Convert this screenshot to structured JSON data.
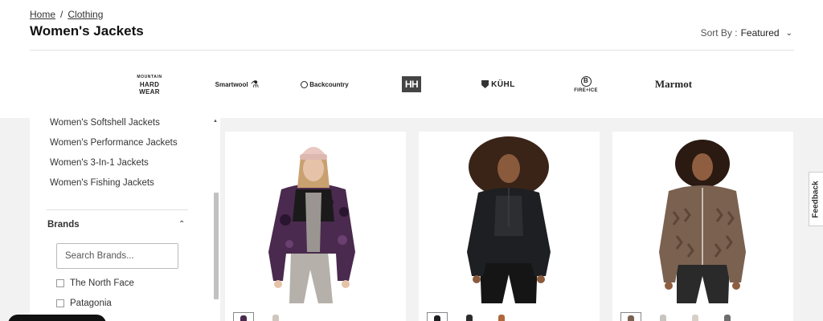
{
  "breadcrumb": {
    "home": "Home",
    "separator": "/",
    "current": "Clothing"
  },
  "page_title": "Women's Jackets",
  "sort": {
    "label": "Sort By :",
    "value": "Featured"
  },
  "brand_logos": [
    {
      "name": "Mountain Hardwear",
      "line1": "MOUNTAIN",
      "line2": "HARD",
      "line3": "WEAR"
    },
    {
      "name": "Smartwool",
      "text": "Smartwool"
    },
    {
      "name": "Backcountry",
      "text": "Backcountry"
    },
    {
      "name": "Helly Hansen",
      "text": "HH"
    },
    {
      "name": "Kuhl",
      "text": "KÜHL"
    },
    {
      "name": "Fire + Ice",
      "mark": "B",
      "text": "FIRE+ICE"
    },
    {
      "name": "Marmot",
      "text": "Marmot"
    }
  ],
  "sidebar": {
    "categories": [
      "Women's Softshell Jackets",
      "Women's Performance Jackets",
      "Women's 3-In-1 Jackets",
      "Women's Fishing Jackets"
    ],
    "brands_heading": "Brands",
    "brand_search_placeholder": "Search Brands...",
    "brand_options": [
      "The North Face",
      "Patagonia"
    ]
  },
  "products": [
    {
      "name": "purple-camo-fleece-jacket",
      "colors": {
        "jacket": "#4a2a4e",
        "accent": "#1a1a1a",
        "pants": "#b5b0aa",
        "hair": "#c9a070",
        "hat": "#e8c8c0",
        "skin": "#e6c3a8"
      }
    },
    {
      "name": "black-quilted-pullover",
      "colors": {
        "jacket": "#1e1f22",
        "accent": "#2d2e31",
        "pants": "#151515",
        "hair": "#3a2418",
        "skin": "#8a5a3c"
      }
    },
    {
      "name": "brown-patterned-fleece-jacket",
      "colors": {
        "jacket": "#7a6150",
        "accent": "#5c4636",
        "pants": "#2a2a2a",
        "hair": "#2a1a12",
        "skin": "#8f5e40"
      }
    }
  ],
  "feedback_label": "Feedback"
}
